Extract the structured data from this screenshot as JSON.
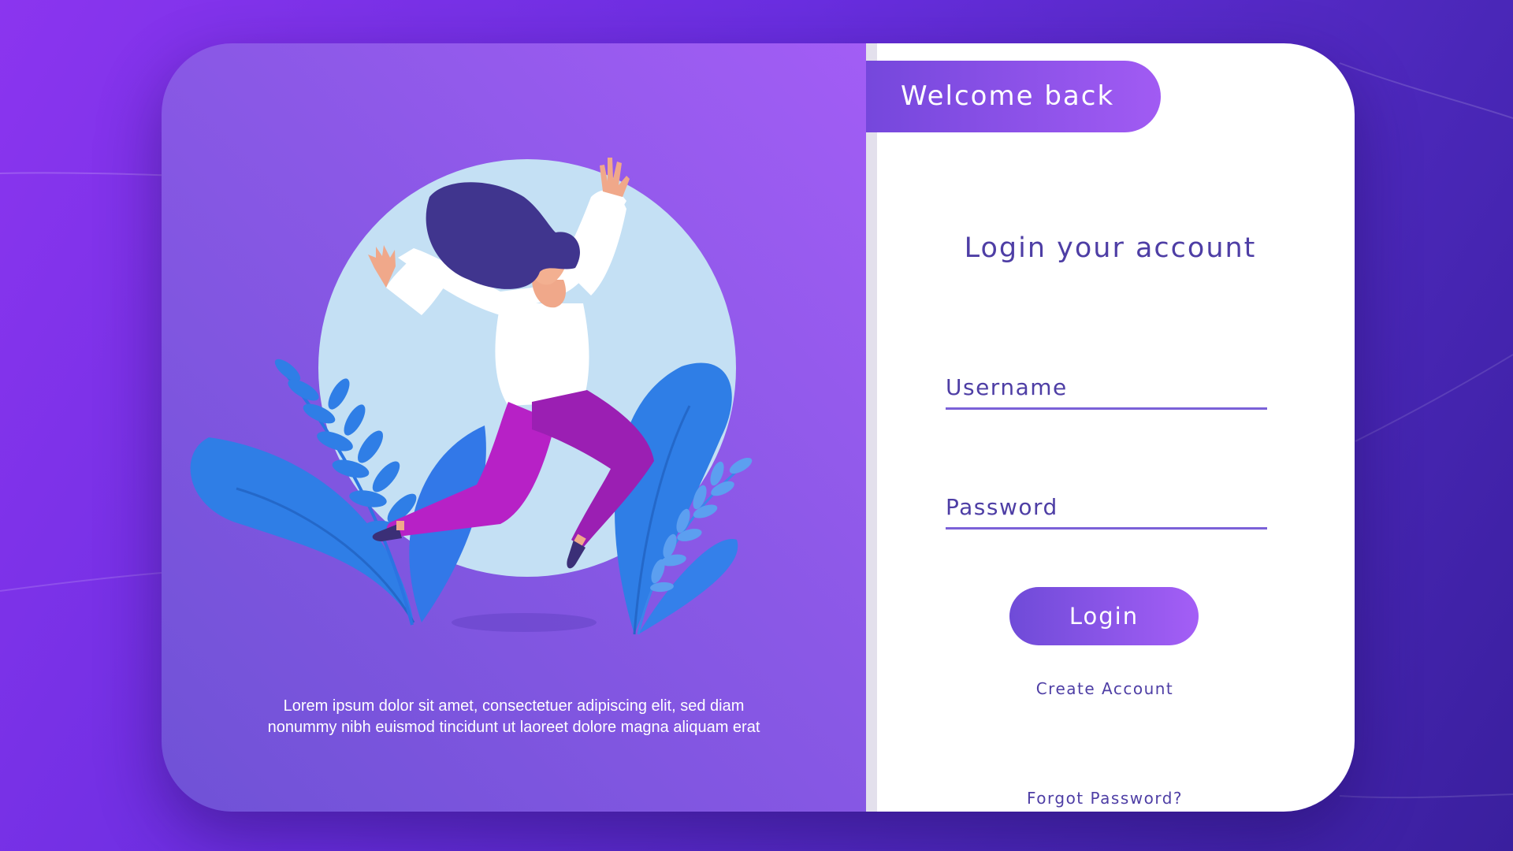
{
  "welcome": {
    "label": "Welcome back"
  },
  "login": {
    "title": "Login your account",
    "username_placeholder": "Username",
    "password_placeholder": "Password",
    "button_label": "Login",
    "create_account_label": "Create Account",
    "forgot_password_label": "Forgot Password?"
  },
  "hero": {
    "caption_line1": "Lorem ipsum dolor sit amet, consectetuer adipiscing elit, sed diam",
    "caption_line2": "nonummy nibh euismod tincidunt ut laoreet dolore magna aliquam erat",
    "illustration_icon": "jumping-woman-illustration"
  },
  "colors": {
    "accent": "#4e3ea5",
    "gradient_start": "#6f4bd8",
    "gradient_end": "#a45ef6",
    "background": "#6a2ee0"
  }
}
